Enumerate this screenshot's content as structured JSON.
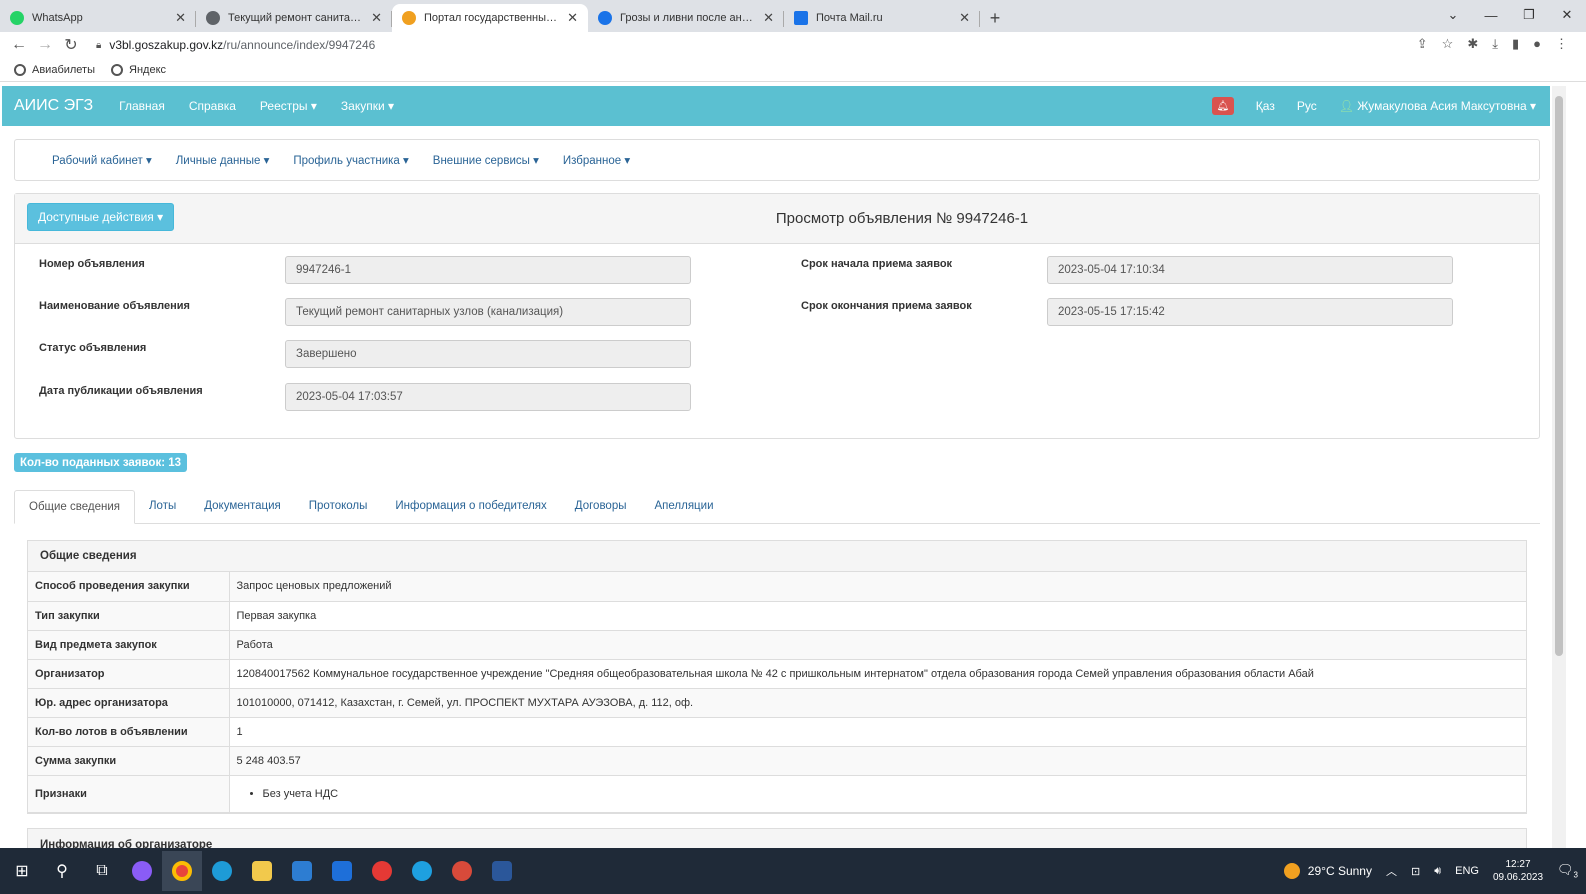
{
  "browser": {
    "tabs": [
      {
        "title": "WhatsApp",
        "color": "#25d366"
      },
      {
        "title": "Текущий ремонт санитарных уз",
        "color": "#5f6368"
      },
      {
        "title": "Портал государственных закупо",
        "color": "#f0a020"
      },
      {
        "title": "Грозы и ливни после аномальн",
        "color": "#1a73e8"
      },
      {
        "title": "Почта Mail.ru",
        "color": "#1a73e8"
      }
    ],
    "url_host": "v3bl.goszakup.gov.kz",
    "url_path": "/ru/announce/index/9947246",
    "bookmarks": [
      "Авиабилеты",
      "Яндекс"
    ]
  },
  "topnav": {
    "brand": "АИИС ЭГЗ",
    "items": [
      "Главная",
      "Справка",
      "Реестры ▾",
      "Закупки ▾"
    ],
    "lang_kz": "Қаз",
    "lang_ru": "Рус",
    "user": "Жумакулова Асия Максутовна ▾"
  },
  "subnav": [
    "Рабочий кабинет ▾",
    "Личные данные ▾",
    "Профиль участника ▾",
    "Внешние сервисы ▾",
    "Избранное ▾"
  ],
  "panel": {
    "actions": "Доступные действия ▾",
    "title": "Просмотр объявления № 9947246-1",
    "left": [
      {
        "label": "Номер объявления",
        "value": "9947246-1"
      },
      {
        "label": "Наименование объявления",
        "value": "Текущий ремонт санитарных узлов (канализация)"
      },
      {
        "label": "Статус объявления",
        "value": "Завершено"
      },
      {
        "label": "Дата публикации объявления",
        "value": "2023-05-04 17:03:57"
      }
    ],
    "right": [
      {
        "label": "Срок начала приема заявок",
        "value": "2023-05-04 17:10:34"
      },
      {
        "label": "Срок окончания приема заявок",
        "value": "2023-05-15 17:15:42"
      }
    ]
  },
  "badge": "Кол-во поданных заявок: 13",
  "tabs": [
    "Общие сведения",
    "Лоты",
    "Документация",
    "Протоколы",
    "Информация о победителях",
    "Договоры",
    "Апелляции"
  ],
  "general": {
    "heading": "Общие сведения",
    "rows": [
      {
        "k": "Способ проведения закупки",
        "v": "Запрос ценовых предложений"
      },
      {
        "k": "Тип закупки",
        "v": "Первая закупка"
      },
      {
        "k": "Вид предмета закупок",
        "v": "Работа"
      },
      {
        "k": "Организатор",
        "v": "120840017562 Коммунальное государственное учреждение \"Средняя общеобразовательная школа № 42 с пришкольным интернатом\" отдела образования города Семей управления образования области Абай"
      },
      {
        "k": "Юр. адрес организатора",
        "v": "101010000, 071412, Казахстан, г. Семей, ул. ПРОСПЕКТ МУХТАРА АУЭЗОВА, д. 112, оф."
      },
      {
        "k": "Кол-во лотов в объявлении",
        "v": "1"
      },
      {
        "k": "Сумма закупки",
        "v": "5 248 403.57"
      },
      {
        "k": "Признаки",
        "v": "Без учета НДС"
      }
    ],
    "next_heading": "Информация об организаторе"
  },
  "taskbar": {
    "weather": "29°C Sunny",
    "lang": "ENG",
    "time": "12:27",
    "date": "09.06.2023",
    "notifications": "3"
  }
}
